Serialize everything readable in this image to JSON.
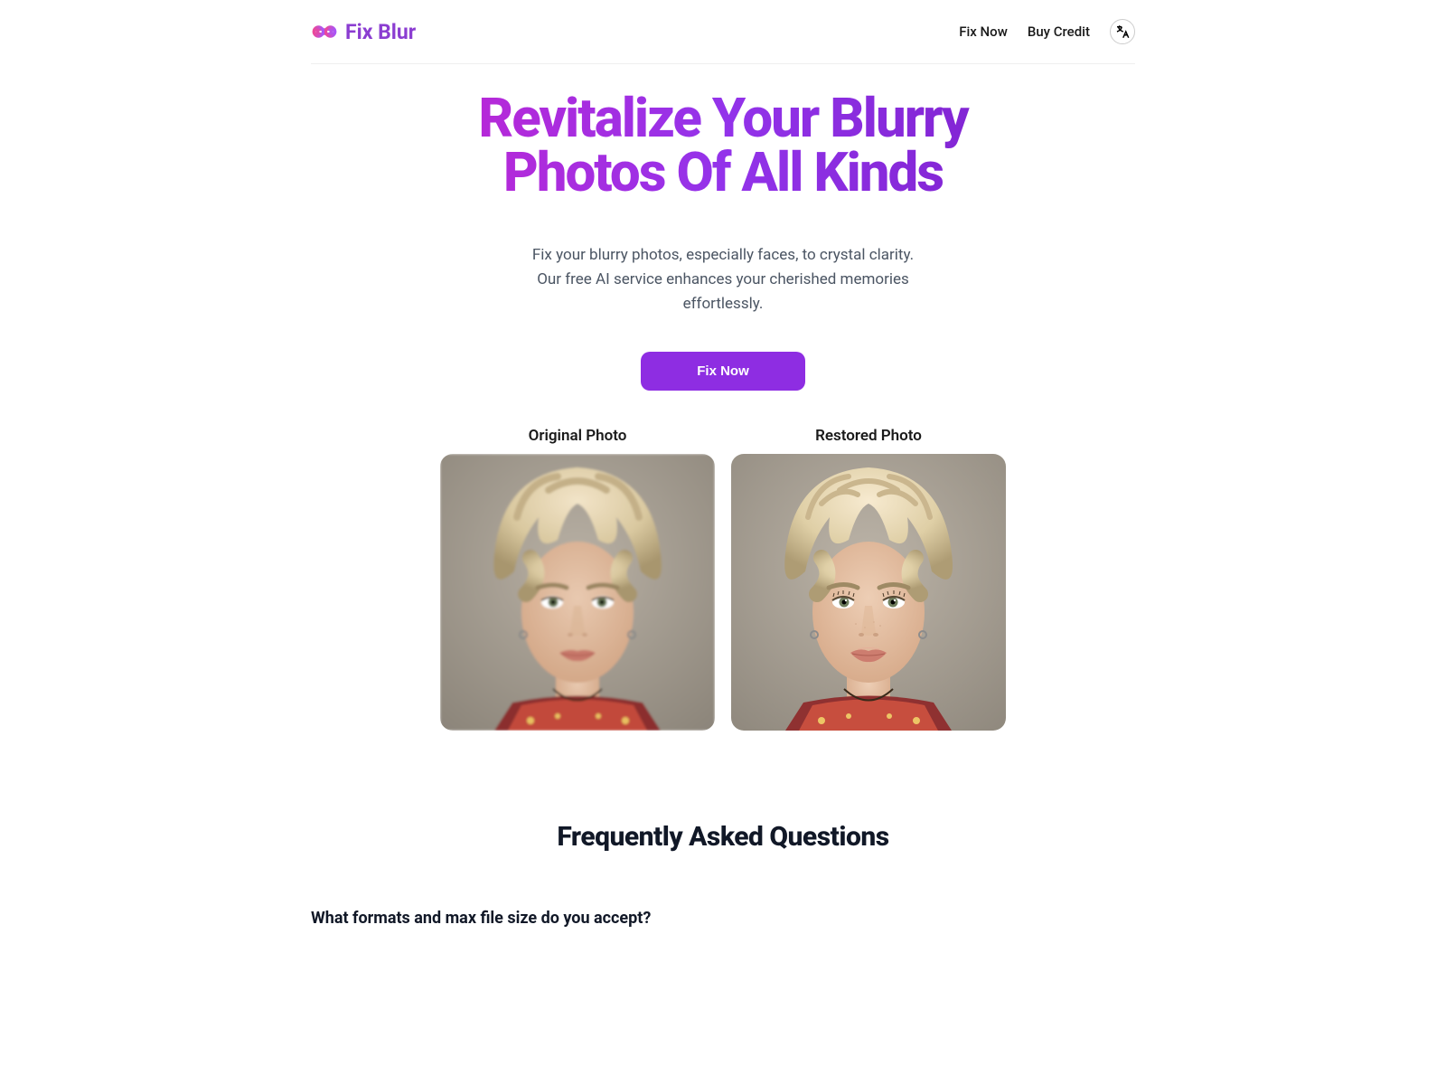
{
  "header": {
    "logo_text": "Fix Blur",
    "nav": {
      "fix_now": "Fix Now",
      "buy_credit": "Buy Credit"
    }
  },
  "hero": {
    "title": "Revitalize Your Blurry Photos Of All Kinds",
    "description": "Fix your blurry photos, especially faces, to crystal clarity. Our free AI service enhances your cherished memories effortlessly.",
    "cta_label": "Fix Now"
  },
  "comparison": {
    "original_label": "Original Photo",
    "restored_label": "Restored Photo"
  },
  "faq": {
    "title": "Frequently Asked Questions",
    "items": [
      {
        "question": "What formats and max file size do you accept?"
      }
    ]
  }
}
